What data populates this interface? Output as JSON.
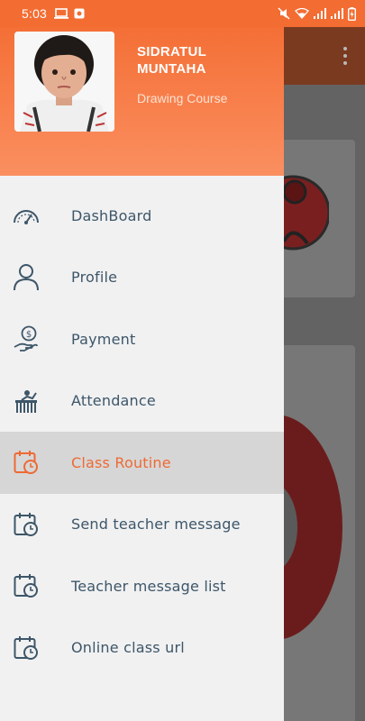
{
  "status_bar": {
    "time": "5:03",
    "icons": [
      "laptop-icon",
      "notification-app-icon",
      "mute-icon",
      "wifi-icon",
      "signal-icon",
      "signal-icon",
      "battery-charging-icon"
    ]
  },
  "colors": {
    "accent": "#f36d33",
    "menu_text": "#3d5668",
    "active_text": "#ee6a33",
    "active_bg": "#d6d6d7"
  },
  "drawer": {
    "user_name": "SIDRATUL MUNTAHA",
    "course": "Drawing Course",
    "items": [
      {
        "label": "DashBoard",
        "icon": "speedometer-icon"
      },
      {
        "label": "Profile",
        "icon": "person-icon"
      },
      {
        "label": "Payment",
        "icon": "dollar-hand-icon"
      },
      {
        "label": "Attendance",
        "icon": "teacher-desk-icon"
      },
      {
        "label": "Class Routine",
        "icon": "calendar-clock-icon",
        "active": true
      },
      {
        "label": "Send teacher message",
        "icon": "calendar-clock-icon"
      },
      {
        "label": "Teacher message list",
        "icon": "calendar-clock-icon"
      },
      {
        "label": "Online class url",
        "icon": "calendar-clock-icon"
      }
    ]
  }
}
